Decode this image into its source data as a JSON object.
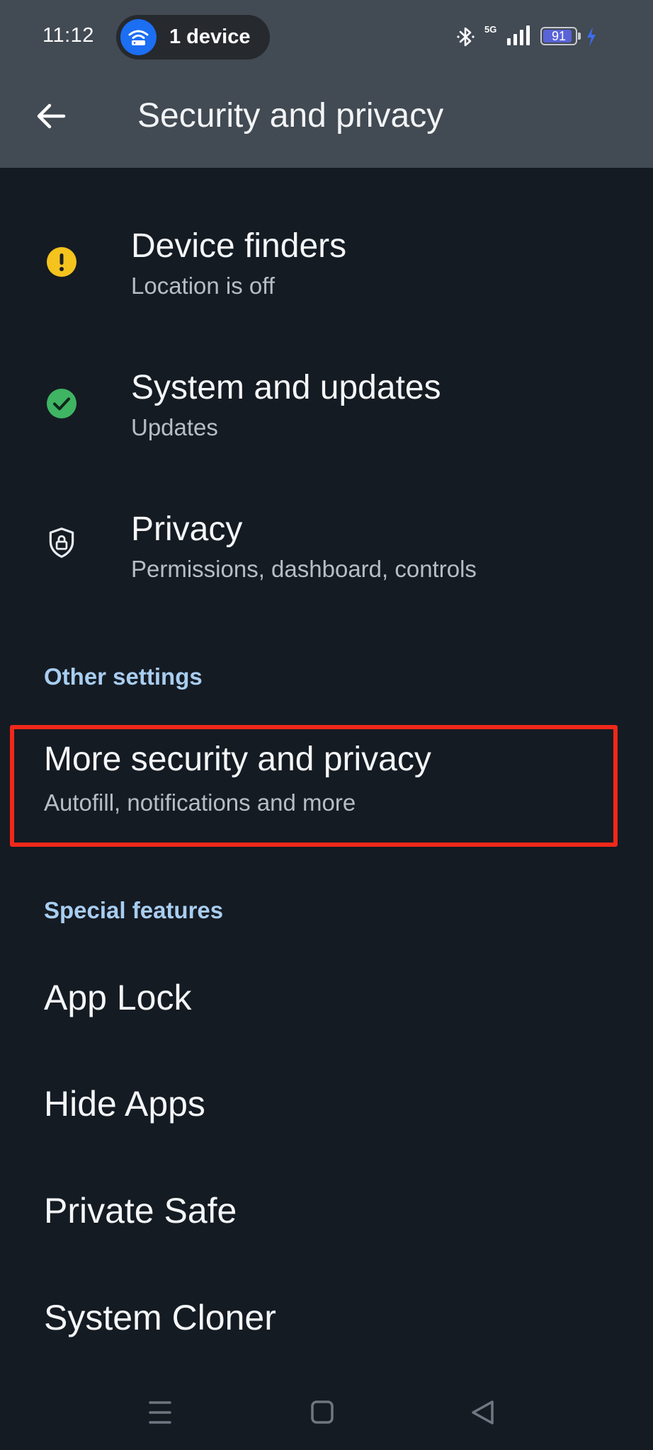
{
  "status_bar": {
    "time": "11:12",
    "hotspot_label": "1 device",
    "network_type": "5G",
    "battery_level": "91",
    "battery_percent": 91
  },
  "app_bar": {
    "title": "Security and privacy"
  },
  "items": [
    {
      "title": "Device finders",
      "subtitle": "Location is off",
      "icon": "warning-icon"
    },
    {
      "title": "System and updates",
      "subtitle": "Updates",
      "icon": "check-circle-icon"
    },
    {
      "title": "Privacy",
      "subtitle": "Permissions, dashboard, controls",
      "icon": "shield-lock-icon"
    }
  ],
  "other_settings": {
    "header": "Other settings",
    "item": {
      "title": "More security and privacy",
      "subtitle": "Autofill, notifications and more"
    }
  },
  "special_features": {
    "header": "Special features",
    "items": [
      "App Lock",
      "Hide Apps",
      "Private Safe",
      "System Cloner"
    ]
  },
  "colors": {
    "warning": "#f5c31d",
    "success": "#3fb463",
    "section_header": "#a8cdf0",
    "highlight": "#f0281a"
  }
}
